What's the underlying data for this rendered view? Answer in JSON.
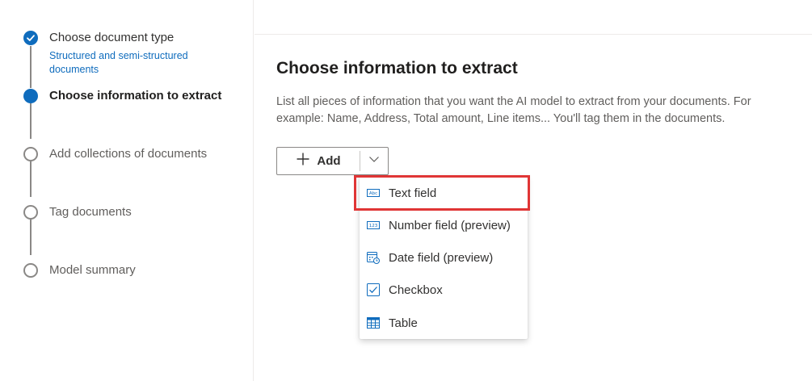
{
  "steps": [
    {
      "label": "Choose document type",
      "sublabel": "Structured and semi-structured documents",
      "state": "done"
    },
    {
      "label": "Choose information to extract",
      "state": "current"
    },
    {
      "label": "Add collections of documents",
      "state": "todo"
    },
    {
      "label": "Tag documents",
      "state": "todo"
    },
    {
      "label": "Model summary",
      "state": "todo"
    }
  ],
  "main": {
    "title": "Choose information to extract",
    "description": "List all pieces of information that you want the AI model to extract from your documents. For example: Name, Address, Total amount, Line items... You'll tag them in the documents."
  },
  "add_button": {
    "label": "Add",
    "icon": "plus-icon",
    "dropdown_icon": "chevron-down-icon"
  },
  "menu": {
    "items": [
      {
        "label": "Text field",
        "icon": "text-field-icon"
      },
      {
        "label": "Number field (preview)",
        "icon": "number-field-icon"
      },
      {
        "label": "Date field (preview)",
        "icon": "calendar-icon"
      },
      {
        "label": "Checkbox",
        "icon": "checkbox-icon"
      },
      {
        "label": "Table",
        "icon": "table-icon"
      }
    ],
    "highlighted_item": "Text field"
  },
  "colors": {
    "accent": "#0f6cbd",
    "highlight_border": "#e03535",
    "step_inactive": "#8a8886"
  }
}
